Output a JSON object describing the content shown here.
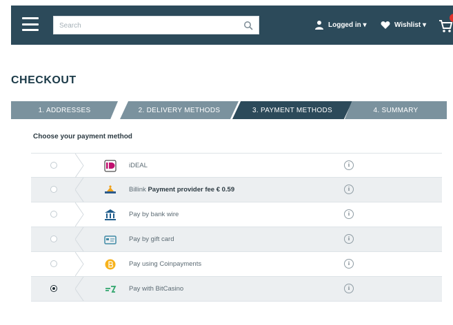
{
  "header": {
    "search_placeholder": "Search",
    "login_label": "Logged in ▾",
    "wishlist_label": "Wishlist ▾",
    "colors": {
      "bar": "#2c4a5a",
      "badge": "#e2312b"
    }
  },
  "page": {
    "title": "CHECKOUT",
    "choose_label": "Choose your payment method"
  },
  "steps": [
    {
      "label": "1. ADDRESSES",
      "active": false
    },
    {
      "label": "2. DELIVERY METHODS",
      "active": false
    },
    {
      "label": "3. PAYMENT METHODS",
      "active": true
    },
    {
      "label": "4. SUMMARY",
      "active": false
    }
  ],
  "payments": [
    {
      "icon": "ideal-icon",
      "label": "iDEAL",
      "extra": "",
      "selected": false
    },
    {
      "icon": "billink-icon",
      "label": "Billink",
      "extra": "Payment provider fee € 0.59",
      "selected": false
    },
    {
      "icon": "bank-icon",
      "label": "Pay by bank wire",
      "extra": "",
      "selected": false
    },
    {
      "icon": "gift-card-icon",
      "label": "Pay by gift card",
      "extra": "",
      "selected": false
    },
    {
      "icon": "bitcoin-icon",
      "label": "Pay using Coinpayments",
      "extra": "",
      "selected": false
    },
    {
      "icon": "bitcoin-cash-icon",
      "label": "Pay with BitCasino",
      "extra": "",
      "selected": true
    }
  ],
  "info_glyph": "i"
}
